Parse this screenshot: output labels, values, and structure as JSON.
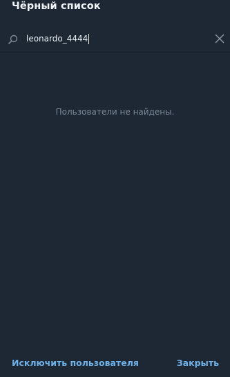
{
  "dialog": {
    "title": "Чёрный список"
  },
  "search": {
    "value": "leonardo_4444",
    "icon": "search-icon",
    "clear_icon": "close-icon"
  },
  "empty_state": {
    "text": "Пользователи не найдены."
  },
  "footer": {
    "unblock_label": "Исключить пользователя",
    "close_label": "Закрыть"
  },
  "colors": {
    "background": "#1e2834",
    "accent": "#6eb0e8",
    "muted_text": "#7b8a98"
  }
}
